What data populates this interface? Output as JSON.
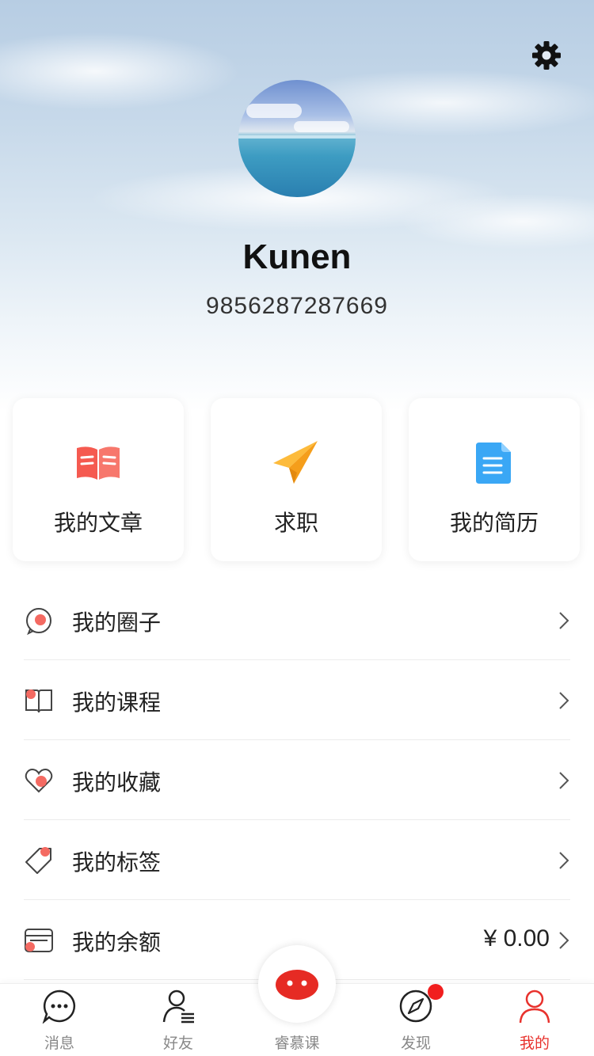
{
  "theme": {
    "accent": "#e8322d",
    "badge": "#f11e1e"
  },
  "header": {
    "settings_icon": "gear-icon",
    "avatar_alt": "ocean-sky-avatar",
    "username": "Kunen",
    "user_id": "9856287287669"
  },
  "cards": [
    {
      "label": "我的文章",
      "icon": "book-icon"
    },
    {
      "label": "求职",
      "icon": "paper-plane-icon"
    },
    {
      "label": "我的简历",
      "icon": "document-icon"
    }
  ],
  "menu": [
    {
      "label": "我的圈子",
      "icon": "chat-circle-icon",
      "value": ""
    },
    {
      "label": "我的课程",
      "icon": "open-book-icon",
      "value": ""
    },
    {
      "label": "我的收藏",
      "icon": "heart-icon",
      "value": ""
    },
    {
      "label": "我的标签",
      "icon": "tag-icon",
      "value": ""
    },
    {
      "label": "我的余额",
      "icon": "wallet-icon",
      "value": "¥ 0.00"
    }
  ],
  "tabbar": {
    "tabs": [
      {
        "label": "消息",
        "icon": "message-icon",
        "active": false
      },
      {
        "label": "好友",
        "icon": "friends-icon",
        "active": false
      },
      {
        "label": "睿慕课",
        "icon": "mascot-icon",
        "active": false
      },
      {
        "label": "发现",
        "icon": "compass-icon",
        "active": false,
        "badge": true
      },
      {
        "label": "我的",
        "icon": "profile-icon",
        "active": true
      }
    ]
  }
}
